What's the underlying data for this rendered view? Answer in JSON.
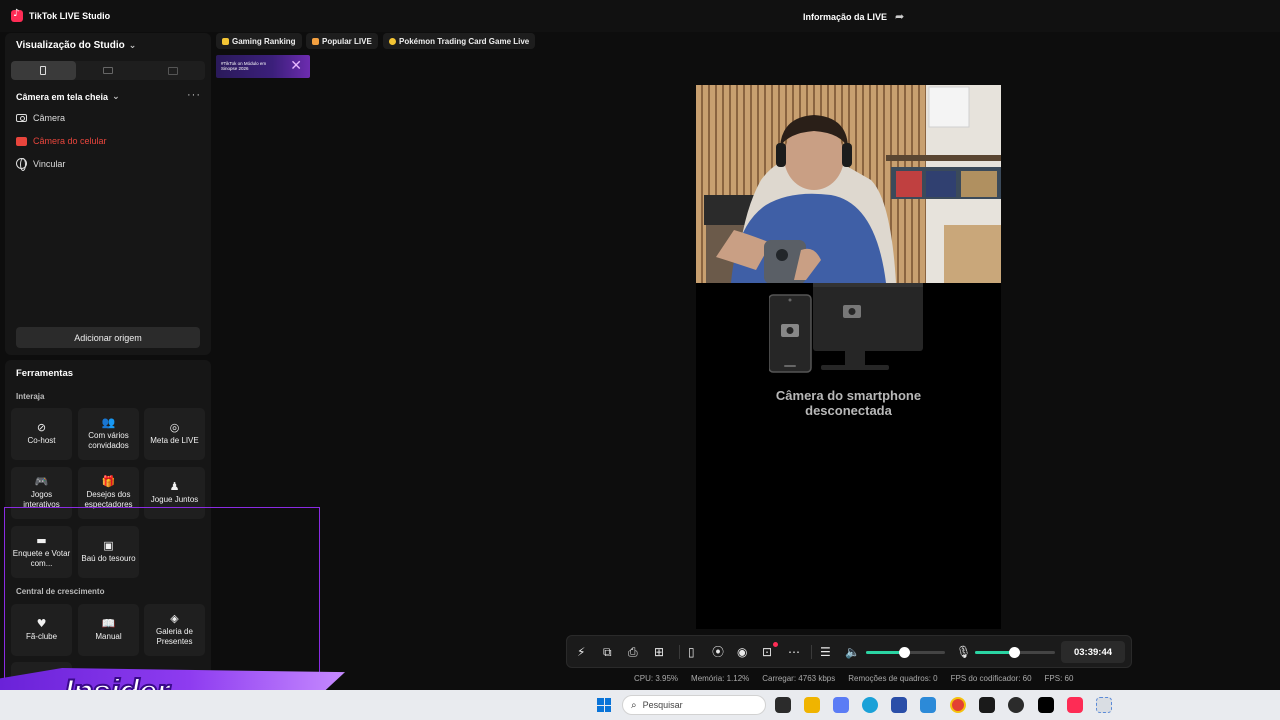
{
  "app": {
    "title": "TikTok LIVE Studio",
    "live_info": "Informação da LIVE"
  },
  "studio": {
    "title": "Visualização do Studio",
    "camera_mode": "Câmera em tela cheia",
    "sources": [
      "Câmera",
      "Câmera do celular",
      "Vincular"
    ],
    "add_source": "Adicionar origem"
  },
  "tools": {
    "title": "Ferramentas",
    "sections": {
      "interact": "Interaja",
      "growth": "Central de crescimento"
    },
    "items": {
      "cohost": "Co-host",
      "multi": "Com vários convidados",
      "goal": "Meta de LIVE",
      "games": "Jogos interativos",
      "wishes": "Desejos dos espectadores",
      "play": "Jogue Juntos",
      "poll": "Enquete e Votar com...",
      "chest": "Baú do tesouro",
      "fanclub": "Fã-clube",
      "manual": "Manual",
      "gallery": "Galeria de Presentes"
    }
  },
  "chips": [
    "Gaming Ranking",
    "Popular LIVE",
    "Pokémon Trading Card Game Live"
  ],
  "banner": {
    "text": "#TikTok on Módulo em Sinopse 2026"
  },
  "preview": {
    "disconnected_line1": "Câmera do smartphone",
    "disconnected_line2": "desconectada"
  },
  "controls": {
    "timer": "03:39:44",
    "volume_level": 0.48,
    "mic_level": 0.49
  },
  "stats": {
    "cpu": "CPU:  3.95%",
    "memory": "Memória:  1.12%",
    "upload": "Carregar:  4763 kbps",
    "dropped": "Remoções de quadros:  0",
    "encoder_fps": "FPS do codificador:  60",
    "fps": "FPS:  60"
  },
  "overlay": {
    "logo": "Insider"
  },
  "taskbar": {
    "search_placeholder": "Pesquisar"
  },
  "colors": {
    "accent_live": "#fe2c55",
    "slider": "#2bd4a3",
    "overlay_purple": "#8a2be2"
  }
}
